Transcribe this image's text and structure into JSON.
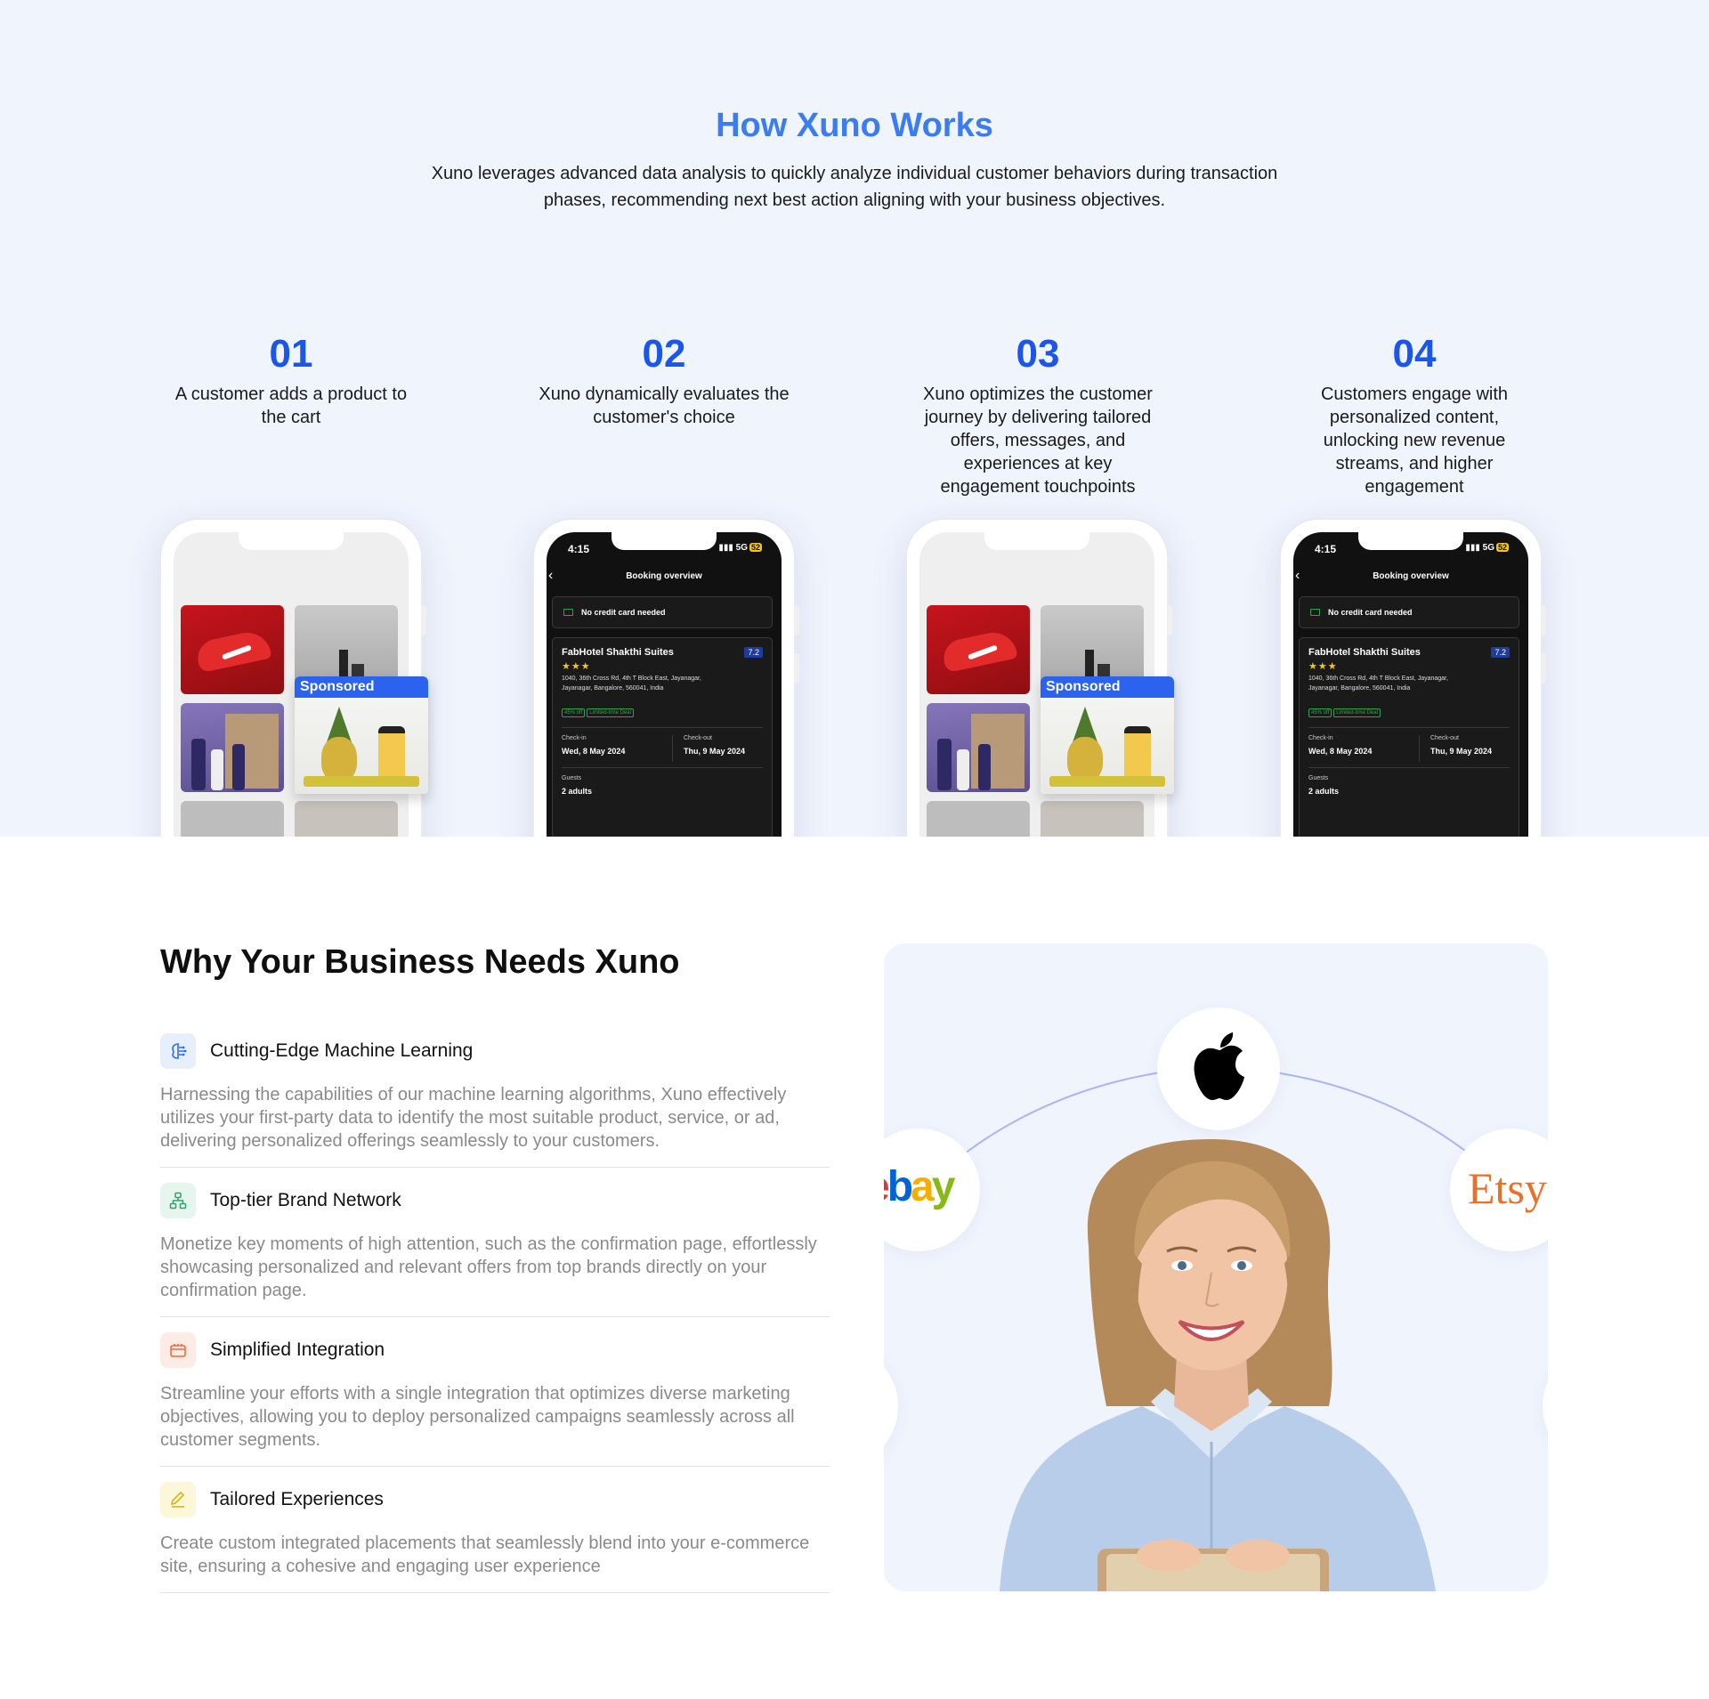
{
  "how": {
    "title": "How Xuno Works",
    "subtitle": "Xuno leverages advanced data analysis to quickly analyze individual customer behaviors during transaction phases, recommending next best action aligning with your business objectives.",
    "steps": [
      {
        "num": "01",
        "text": "A customer adds a product to the cart"
      },
      {
        "num": "02",
        "text": "Xuno dynamically evaluates the customer's choice"
      },
      {
        "num": "03",
        "text": "Xuno optimizes the customer journey by delivering tailored offers, messages, and experiences at key engagement touchpoints"
      },
      {
        "num": "04",
        "text": "Customers engage with personalized content, unlocking new revenue streams, and higher engagement"
      }
    ],
    "sponsored_label": "Sponsored",
    "booking": {
      "time": "4:15",
      "network": "5G",
      "battery": "52",
      "header": "Booking overview",
      "banner": "No credit card needed",
      "hotel": "FabHotel Shakthi Suites",
      "score": "7.2",
      "stars": "★★★",
      "address": "1040, 36th Cross Rd, 4th T Block East, Jayanagar, Jayanagar, Bangalore, 560041, India",
      "chips": [
        "45% off",
        "Limited-time Deal"
      ],
      "checkin_label": "Check-in",
      "checkin": "Wed, 8 May 2024",
      "checkout_label": "Check-out",
      "checkout": "Thu, 9 May 2024",
      "guests_label": "Guests",
      "guests": "2 adults"
    }
  },
  "why": {
    "title": "Why Your Business Needs Xuno",
    "features": [
      {
        "title": "Cutting-Edge Machine Learning",
        "text": "Harnessing the capabilities of our machine learning algorithms, Xuno effectively utilizes your first-party data to identify the most suitable product, service, or ad, delivering personalized offerings seamlessly to your customers.",
        "icon": "brain-icon",
        "color": "#2f6df2",
        "bg": "#e7eefc"
      },
      {
        "title": "Top-tier Brand Network",
        "text": "Monetize key moments of high attention, such as the confirmation page, effortlessly showcasing personalized and relevant offers from top brands directly on your confirmation page.",
        "icon": "network-icon",
        "color": "#2fa36b",
        "bg": "#e6f6ee"
      },
      {
        "title": "Simplified Integration",
        "text": "Streamline your efforts with a single integration that optimizes diverse marketing objectives, allowing you to deploy personalized campaigns seamlessly across all customer segments.",
        "icon": "integration-icon",
        "color": "#ef6a3c",
        "bg": "#fdece6"
      },
      {
        "title": "Tailored Experiences",
        "text": "Create custom integrated placements that seamlessly blend into your e-commerce site, ensuring a cohesive and engaging user experience",
        "icon": "pencil-icon",
        "color": "#d9b21c",
        "bg": "#fdf7d9"
      }
    ],
    "brands": {
      "ebay": "ebay",
      "etsy": "Etsy",
      "apple": "apple-logo"
    }
  }
}
